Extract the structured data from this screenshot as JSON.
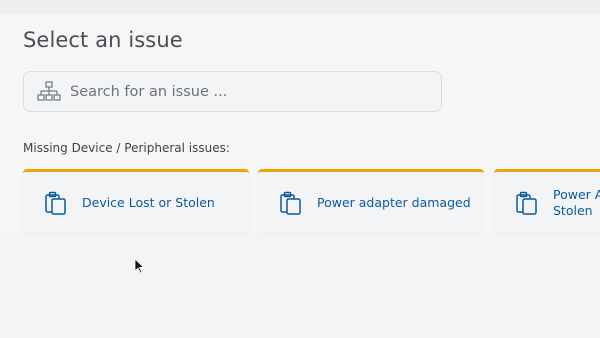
{
  "page": {
    "title": "Select an issue"
  },
  "search": {
    "placeholder": "Search for an issue ...",
    "icon": "hierarchy-icon"
  },
  "section": {
    "label": "Missing Device / Peripheral issues:"
  },
  "cards": [
    {
      "label": "Device Lost or Stolen",
      "icon": "clipboard-icon"
    },
    {
      "label": "Power adapter damaged",
      "icon": "clipboard-icon"
    },
    {
      "label": "Power A Stolen",
      "icon": "clipboard-icon"
    }
  ],
  "colors": {
    "accent": "#f0a500",
    "link": "#0b5a9e",
    "title": "#4a4f55"
  }
}
